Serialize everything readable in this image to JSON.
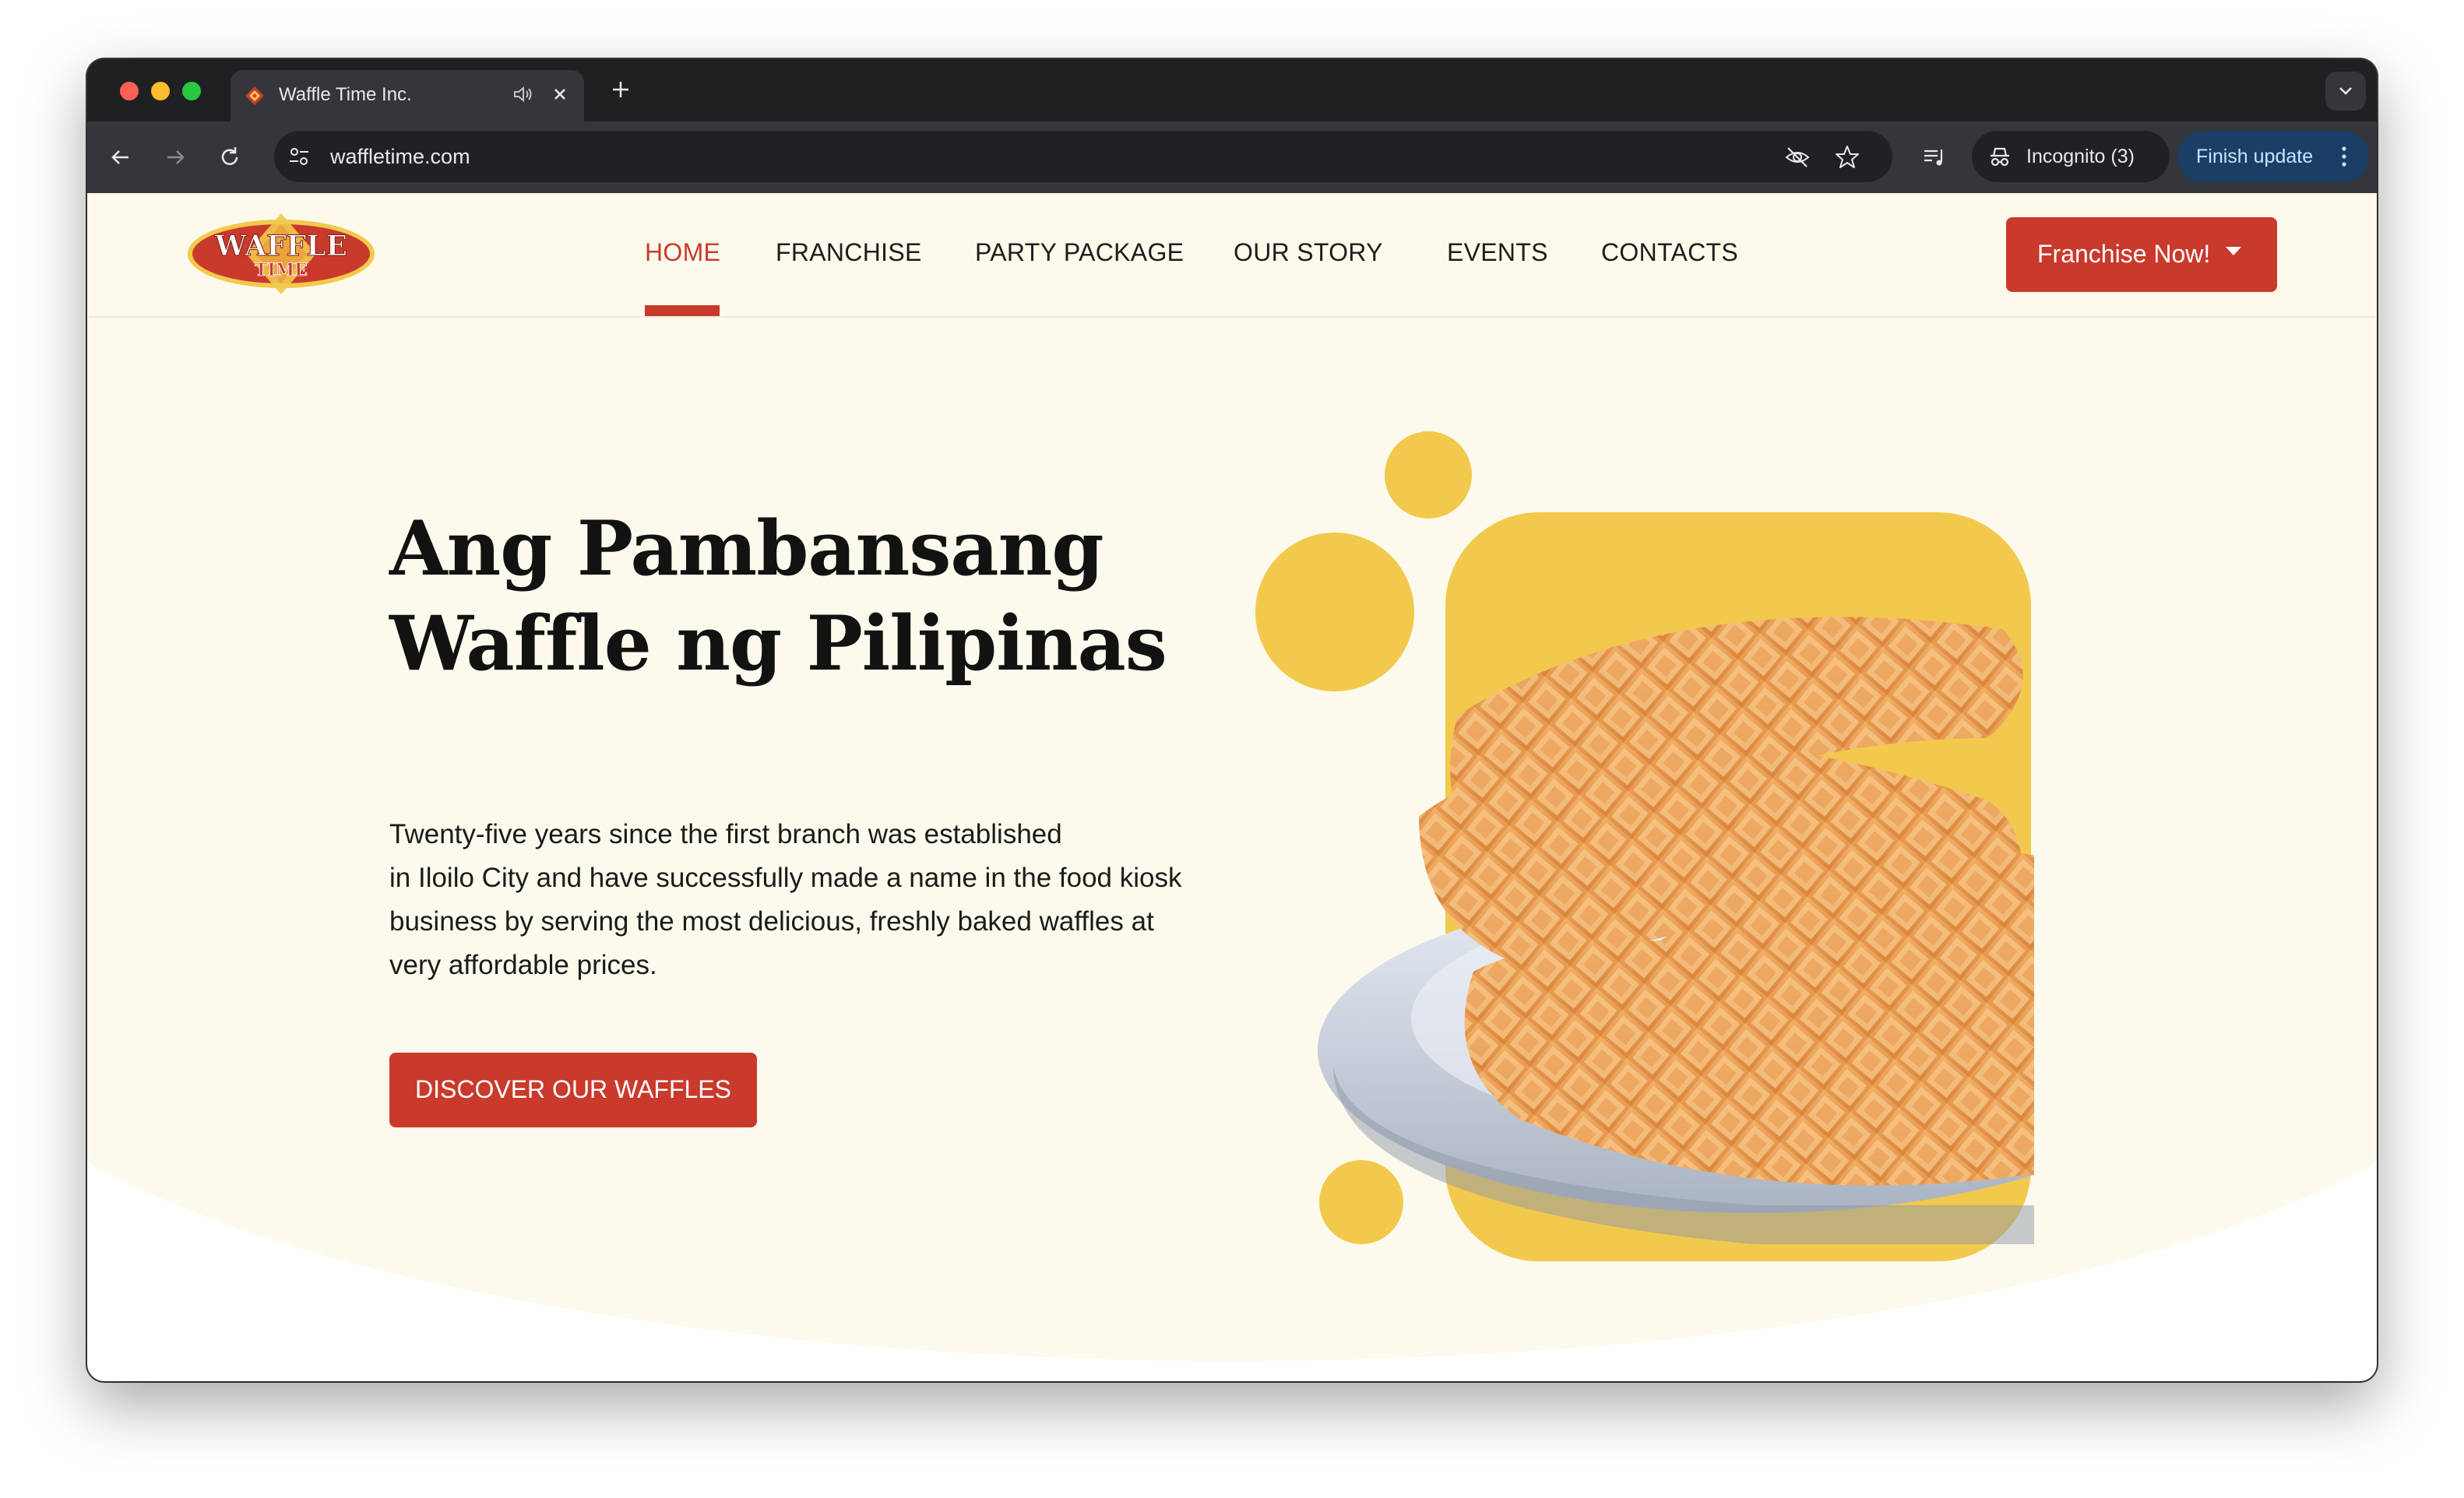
{
  "browser": {
    "tab": {
      "title": "Waffle Time Inc."
    },
    "address_bar": {
      "url": "waffletime.com"
    },
    "profile": {
      "incognito_label": "Incognito (3)"
    },
    "update_button": {
      "label": "Finish update"
    }
  },
  "site": {
    "logo": {
      "text_top": "WAFFLE",
      "text_bottom": "TIME"
    },
    "nav": {
      "items": [
        {
          "label": "HOME",
          "active": true
        },
        {
          "label": "FRANCHISE"
        },
        {
          "label": "PARTY PACKAGE"
        },
        {
          "label": "OUR STORY"
        },
        {
          "label": "EVENTS"
        },
        {
          "label": "CONTACTS"
        }
      ]
    },
    "cta": {
      "label": "Franchise Now!"
    },
    "hero": {
      "headline_lines": [
        "Ang Pambansang",
        "Waffle ng Pilipinas"
      ],
      "description_lines": [
        "Twenty-five years since the first branch was established",
        "in Iloilo City and have successfully made a name in the food kiosk",
        "business by serving the most delicious, freshly baked waffles at",
        "very affordable prices."
      ],
      "button_label": "DISCOVER OUR WAFFLES"
    }
  },
  "colors": {
    "brand_red": "#c93a2c",
    "accent_yellow": "#f2c94c",
    "cream_background": "#fcfaec"
  }
}
